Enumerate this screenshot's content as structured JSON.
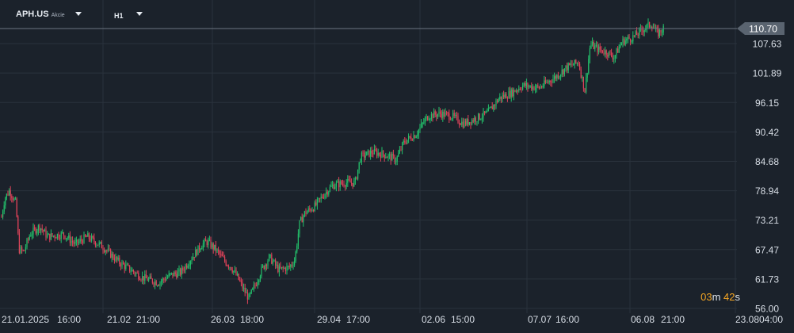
{
  "toolbar": {
    "symbol": "APH.US",
    "instrument_type": "Akcie",
    "timeframe": "H1"
  },
  "countdown": {
    "minutes": "03",
    "m_unit": "m",
    "seconds": "42",
    "s_unit": "s"
  },
  "colors": {
    "background": "#1b222b",
    "grid": "#2a323c",
    "bull": "#23c16b",
    "bear": "#e0435a",
    "price_tag": "#5a6470"
  },
  "chart_data": {
    "type": "candlestick",
    "title": "",
    "current_price": "110.70",
    "y_ticks": [
      "107.63",
      "101.89",
      "96.15",
      "90.42",
      "84.68",
      "78.94",
      "73.21",
      "67.47",
      "61.73",
      "56.00"
    ],
    "ylim": [
      56.0,
      113.4
    ],
    "x_ticks": [
      "21.01.2025",
      "16:00",
      "21.02",
      "21:00",
      "26.03",
      "18:00",
      "29.04",
      "17:00",
      "02.06",
      "15:00",
      "07.07",
      "16:00",
      "06.08",
      "21:00",
      "23.08",
      "04:00"
    ],
    "grid": true,
    "price_path": [
      [
        0,
        72.0
      ],
      [
        6,
        77.5
      ],
      [
        12,
        79.0
      ],
      [
        20,
        76.5
      ],
      [
        24,
        67.5
      ],
      [
        30,
        67.0
      ],
      [
        38,
        70.5
      ],
      [
        50,
        72.0
      ],
      [
        60,
        70.0
      ],
      [
        80,
        70.5
      ],
      [
        95,
        68.5
      ],
      [
        110,
        70.0
      ],
      [
        130,
        68.0
      ],
      [
        150,
        65.0
      ],
      [
        165,
        63.5
      ],
      [
        180,
        62.0
      ],
      [
        200,
        61.0
      ],
      [
        215,
        62.5
      ],
      [
        228,
        63.0
      ],
      [
        240,
        65.5
      ],
      [
        255,
        68.5
      ],
      [
        262,
        69.0
      ],
      [
        272,
        67.5
      ],
      [
        285,
        65.0
      ],
      [
        292,
        64.0
      ],
      [
        300,
        62.0
      ],
      [
        308,
        59.5
      ],
      [
        314,
        58.0
      ],
      [
        322,
        60.5
      ],
      [
        330,
        63.5
      ],
      [
        340,
        66.0
      ],
      [
        352,
        63.5
      ],
      [
        365,
        64.0
      ],
      [
        372,
        65.5
      ],
      [
        378,
        72.5
      ],
      [
        384,
        74.5
      ],
      [
        398,
        76.0
      ],
      [
        410,
        78.5
      ],
      [
        420,
        80.0
      ],
      [
        435,
        80.5
      ],
      [
        448,
        80.5
      ],
      [
        455,
        85.5
      ],
      [
        470,
        86.5
      ],
      [
        485,
        86.0
      ],
      [
        500,
        85.0
      ],
      [
        510,
        88.5
      ],
      [
        525,
        90.0
      ],
      [
        540,
        93.5
      ],
      [
        555,
        94.0
      ],
      [
        570,
        93.5
      ],
      [
        585,
        92.0
      ],
      [
        600,
        93.0
      ],
      [
        615,
        94.0
      ],
      [
        630,
        97.0
      ],
      [
        645,
        98.0
      ],
      [
        660,
        99.5
      ],
      [
        680,
        99.0
      ],
      [
        700,
        101.0
      ],
      [
        715,
        103.0
      ],
      [
        730,
        104.0
      ],
      [
        738,
        98.5
      ],
      [
        745,
        107.5
      ],
      [
        755,
        106.5
      ],
      [
        765,
        106.0
      ],
      [
        775,
        105.0
      ],
      [
        785,
        108.0
      ],
      [
        800,
        109.0
      ],
      [
        812,
        110.5
      ],
      [
        822,
        111.5
      ],
      [
        830,
        109.5
      ],
      [
        838,
        110.7
      ]
    ]
  }
}
